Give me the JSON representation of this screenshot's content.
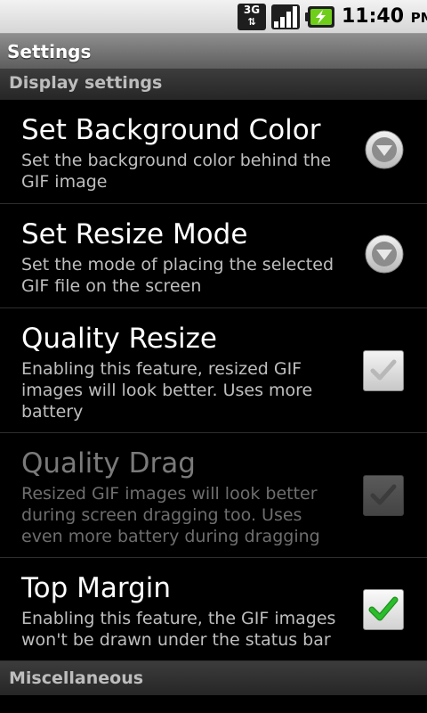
{
  "status_bar": {
    "network_type": "3G",
    "network_arrows": "⇅",
    "time": "11:40",
    "ampm": "PM"
  },
  "title_bar": {
    "title": "Settings"
  },
  "categories": {
    "display": "Display settings",
    "misc": "Miscellaneous"
  },
  "preferences": [
    {
      "title": "Set Background Color",
      "summary": "Set the background color behind the GIF image",
      "widget": "dropdown-icon",
      "enabled": true
    },
    {
      "title": "Set Resize Mode",
      "summary": "Set the mode of placing the selected GIF file on the screen",
      "widget": "dropdown-icon",
      "enabled": true
    },
    {
      "title": "Quality Resize",
      "summary": "Enabling this feature, resized GIF images will look better. Uses more battery",
      "widget": "checkbox",
      "checked": false,
      "enabled": true
    },
    {
      "title": "Quality Drag",
      "summary": "Resized GIF images will look better during screen dragging too. Uses even more battery during dragging",
      "widget": "checkbox",
      "checked": true,
      "enabled": false
    },
    {
      "title": "Top Margin",
      "summary": "Enabling this feature, the GIF images won't be drawn under the status bar",
      "widget": "checkbox",
      "checked": true,
      "enabled": true
    }
  ],
  "colors": {
    "checkmark_green": "#2bbd2b",
    "checkmark_gray": "#b8b8b8",
    "checkmark_disabled": "#3c3c3c",
    "battery_green": "#6fce1a"
  }
}
